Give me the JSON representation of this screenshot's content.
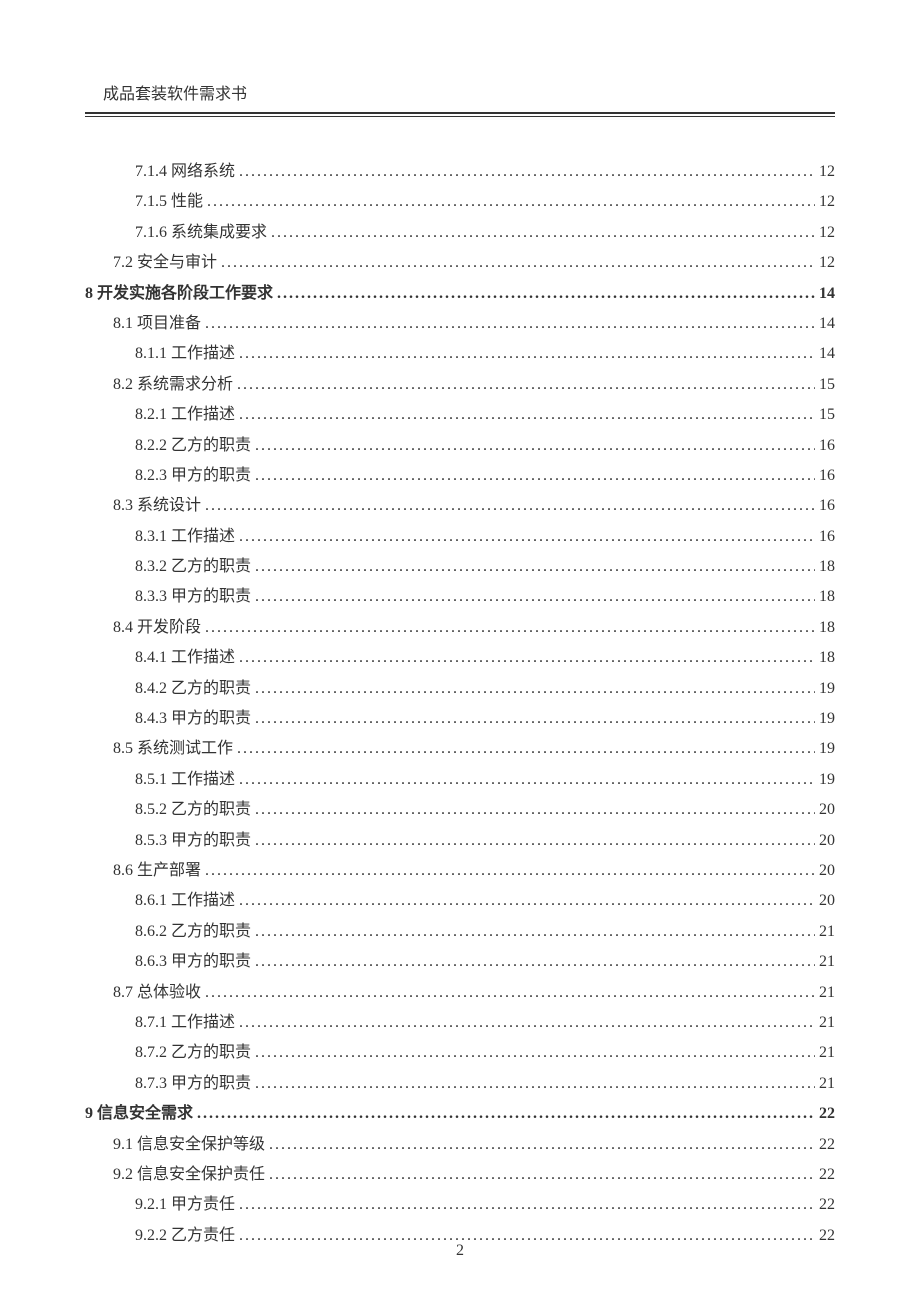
{
  "header": {
    "title": "成品套装软件需求书"
  },
  "pageNumber": "2",
  "toc": [
    {
      "level": 3,
      "num": "7.1.4",
      "title": "网络系统",
      "page": "12"
    },
    {
      "level": 3,
      "num": "7.1.5",
      "title": "性能",
      "page": "12"
    },
    {
      "level": 3,
      "num": "7.1.6",
      "title": "系统集成要求",
      "page": "12"
    },
    {
      "level": 2,
      "num": "7.2",
      "title": "安全与审计",
      "page": "12"
    },
    {
      "level": 1,
      "num": "8",
      "title": "开发实施各阶段工作要求",
      "page": "14"
    },
    {
      "level": 2,
      "num": "8.1",
      "title": "项目准备",
      "page": "14"
    },
    {
      "level": 3,
      "num": "8.1.1",
      "title": "工作描述",
      "page": "14"
    },
    {
      "level": 2,
      "num": "8.2",
      "title": "系统需求分析",
      "page": "15"
    },
    {
      "level": 3,
      "num": "8.2.1",
      "title": "工作描述",
      "page": "15"
    },
    {
      "level": 3,
      "num": "8.2.2",
      "title": "乙方的职责",
      "page": "16"
    },
    {
      "level": 3,
      "num": "8.2.3",
      "title": "甲方的职责",
      "page": "16"
    },
    {
      "level": 2,
      "num": "8.3",
      "title": "系统设计",
      "page": "16"
    },
    {
      "level": 3,
      "num": "8.3.1",
      "title": "工作描述",
      "page": "16"
    },
    {
      "level": 3,
      "num": "8.3.2",
      "title": "乙方的职责",
      "page": "18"
    },
    {
      "level": 3,
      "num": "8.3.3",
      "title": "甲方的职责",
      "page": "18"
    },
    {
      "level": 2,
      "num": "8.4",
      "title": "开发阶段",
      "page": "18"
    },
    {
      "level": 3,
      "num": "8.4.1",
      "title": "工作描述",
      "page": "18"
    },
    {
      "level": 3,
      "num": "8.4.2",
      "title": "乙方的职责",
      "page": "19"
    },
    {
      "level": 3,
      "num": "8.4.3",
      "title": "甲方的职责",
      "page": "19"
    },
    {
      "level": 2,
      "num": "8.5",
      "title": "系统测试工作",
      "page": "19"
    },
    {
      "level": 3,
      "num": "8.5.1",
      "title": "工作描述",
      "page": "19"
    },
    {
      "level": 3,
      "num": "8.5.2",
      "title": "乙方的职责",
      "page": "20"
    },
    {
      "level": 3,
      "num": "8.5.3",
      "title": "甲方的职责",
      "page": "20"
    },
    {
      "level": 2,
      "num": "8.6",
      "title": "生产部署",
      "page": "20"
    },
    {
      "level": 3,
      "num": "8.6.1",
      "title": "工作描述",
      "page": "20"
    },
    {
      "level": 3,
      "num": "8.6.2",
      "title": "乙方的职责",
      "page": "21"
    },
    {
      "level": 3,
      "num": "8.6.3",
      "title": "甲方的职责",
      "page": "21"
    },
    {
      "level": 2,
      "num": "8.7",
      "title": "总体验收",
      "page": "21"
    },
    {
      "level": 3,
      "num": "8.7.1",
      "title": "工作描述",
      "page": "21"
    },
    {
      "level": 3,
      "num": "8.7.2",
      "title": "乙方的职责",
      "page": "21"
    },
    {
      "level": 3,
      "num": "8.7.3",
      "title": "甲方的职责",
      "page": "21"
    },
    {
      "level": 1,
      "num": "9",
      "title": "信息安全需求",
      "page": "22"
    },
    {
      "level": 2,
      "num": "9.1",
      "title": "信息安全保护等级",
      "page": "22"
    },
    {
      "level": 2,
      "num": "9.2",
      "title": "信息安全保护责任",
      "page": "22"
    },
    {
      "level": 3,
      "num": "9.2.1",
      "title": "甲方责任",
      "page": "22"
    },
    {
      "level": 3,
      "num": "9.2.2",
      "title": "乙方责任",
      "page": "22"
    }
  ]
}
